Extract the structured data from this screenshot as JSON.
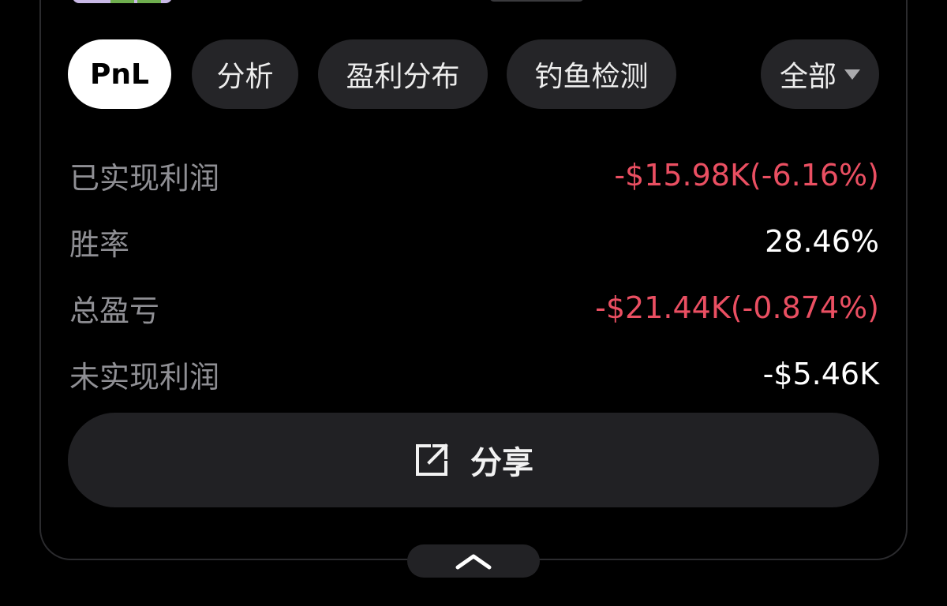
{
  "tabs": {
    "pnl": "PnL",
    "analysis": "分析",
    "profit_distribution": "盈利分布",
    "phishing_detection": "钓鱼检测"
  },
  "filter": {
    "selected": "全部",
    "icon": "caret-down-icon"
  },
  "stats": [
    {
      "label": "已实现利润",
      "value": "-$15.98K(-6.16%)",
      "color": "#ea4f62"
    },
    {
      "label": "胜率",
      "value": "28.46%",
      "color": "#ffffff"
    },
    {
      "label": "总盈亏",
      "value": "-$21.44K(-0.874%)",
      "color": "#ea4f62"
    },
    {
      "label": "未实现利润",
      "value": "-$5.46K",
      "color": "#ffffff"
    }
  ],
  "share": {
    "label": "分享",
    "icon": "share-external-icon"
  },
  "collapse": {
    "icon": "chevron-up-icon"
  },
  "colors": {
    "background": "#000000",
    "chip": "#252528",
    "negative": "#ea4f62",
    "active_tab": "#ffffff"
  }
}
